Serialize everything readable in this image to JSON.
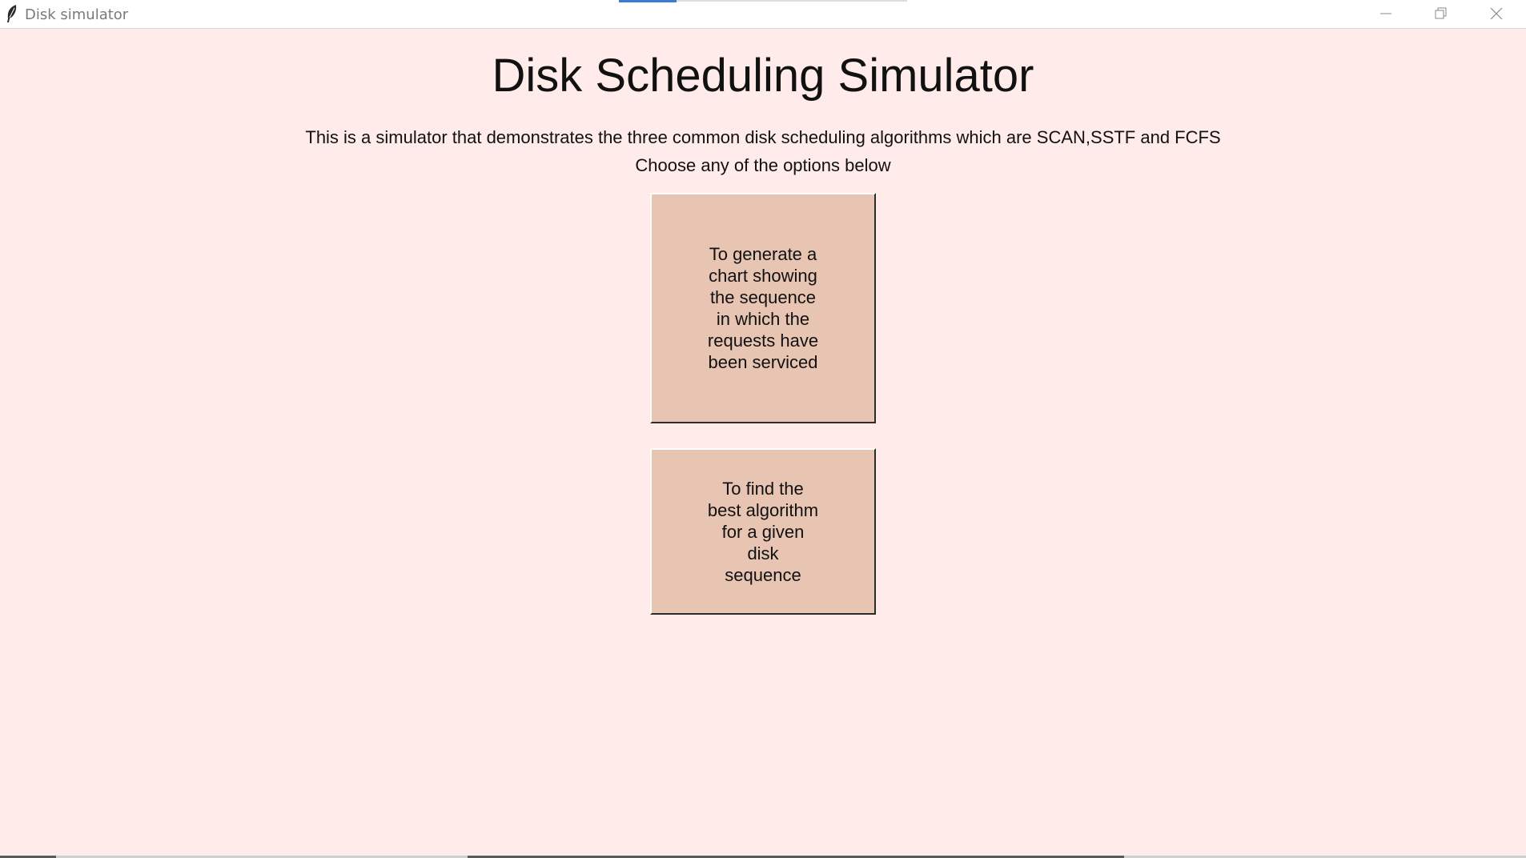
{
  "window": {
    "title": "Disk simulator"
  },
  "main": {
    "heading": "Disk Scheduling Simulator",
    "description": "This is a simulator that demonstrates the three common disk scheduling algorithms which are SCAN,SSTF and FCFS",
    "prompt": "Choose any of the options below",
    "buttons": {
      "chart_label": "To generate a chart showing the sequence in which the requests have been serviced",
      "best_label": "To find the best algorithm for a given disk sequence"
    }
  },
  "colors": {
    "background": "#ffecea",
    "button_face": "#e8c4b3",
    "text": "#111111"
  },
  "icons": {
    "app": "feather-icon",
    "minimize": "minimize-icon",
    "maximize": "restore-icon",
    "close": "close-icon"
  }
}
